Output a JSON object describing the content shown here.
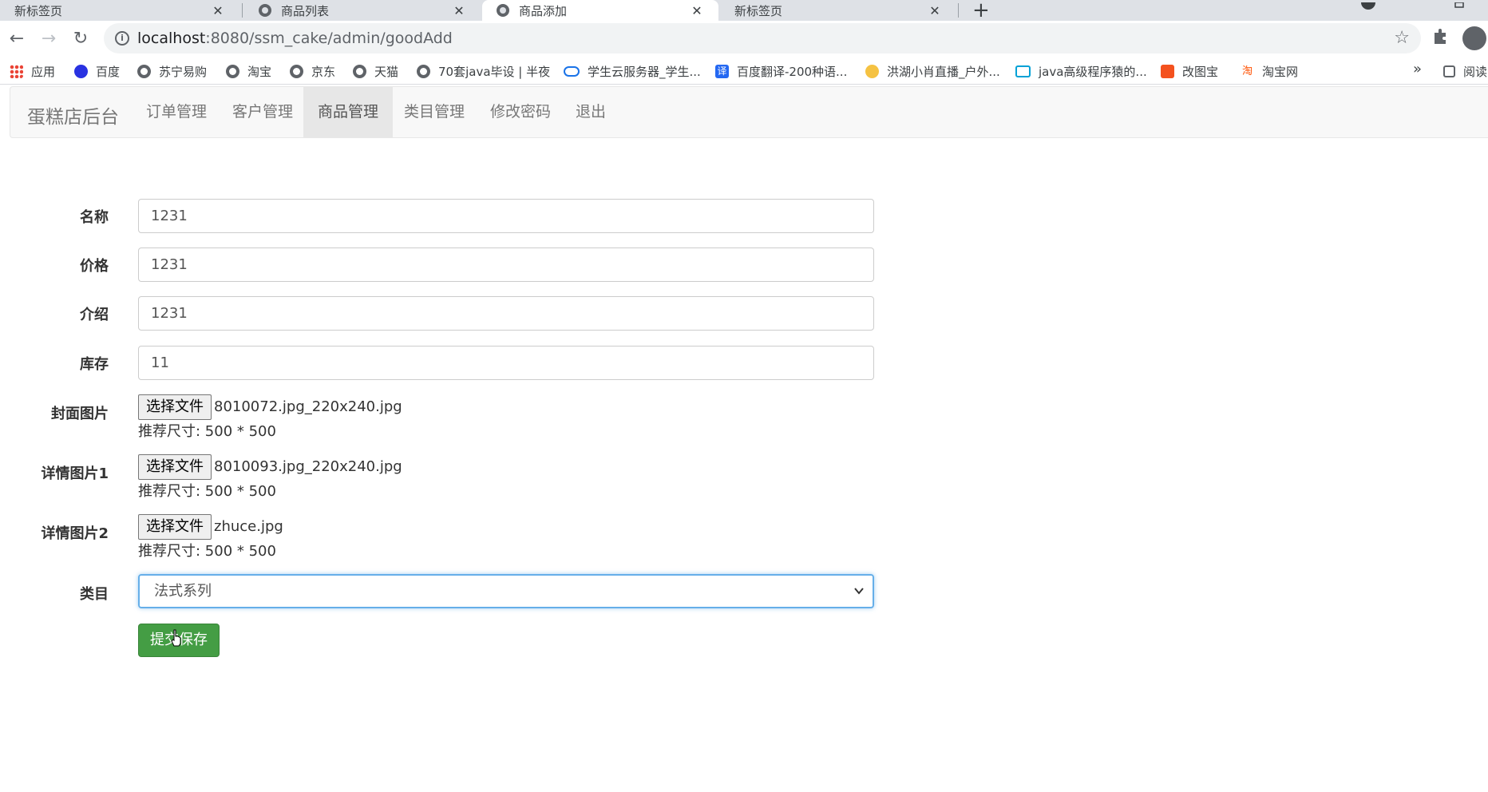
{
  "browser": {
    "tabs": [
      {
        "title": "新标签页"
      },
      {
        "title": "商品列表"
      },
      {
        "title": "商品添加"
      },
      {
        "title": "新标签页"
      }
    ],
    "url_host": "localhost",
    "url_rest": ":8080/ssm_cake/admin/goodAdd",
    "bookmarks": [
      {
        "label": "应用",
        "icon": "apps-grid-icon"
      },
      {
        "label": "百度",
        "icon": "baidu-paw-icon"
      },
      {
        "label": "苏宁易购",
        "icon": "globe-icon"
      },
      {
        "label": "淘宝",
        "icon": "globe-icon"
      },
      {
        "label": "京东",
        "icon": "globe-icon"
      },
      {
        "label": "天猫",
        "icon": "globe-icon"
      },
      {
        "label": "70套java毕设 | 半夜",
        "icon": "globe-icon"
      },
      {
        "label": "学生云服务器_学生...",
        "icon": "cloud-icon"
      },
      {
        "label": "百度翻译-200种语...",
        "icon": "translate-icon"
      },
      {
        "label": "洪湖小肖直播_户外...",
        "icon": "bird-icon"
      },
      {
        "label": "java高级程序猿的...",
        "icon": "bilibili-icon"
      },
      {
        "label": "改图宝",
        "icon": "gaitubao-icon"
      },
      {
        "label": "淘宝网",
        "icon": "taobao-icon"
      }
    ],
    "bookmarks_more": "»",
    "reading_list": "阅读"
  },
  "navbar": {
    "brand": "蛋糕店后台",
    "items": [
      {
        "label": "订单管理"
      },
      {
        "label": "客户管理"
      },
      {
        "label": "商品管理",
        "active": true
      },
      {
        "label": "类目管理"
      },
      {
        "label": "修改密码"
      },
      {
        "label": "退出"
      }
    ]
  },
  "form": {
    "name": {
      "label": "名称",
      "value": "1231"
    },
    "price": {
      "label": "价格",
      "value": "1231"
    },
    "intro": {
      "label": "介绍",
      "value": "1231"
    },
    "stock": {
      "label": "库存",
      "value": "11"
    },
    "cover": {
      "label": "封面图片",
      "button": "选择文件",
      "file": "8010072.jpg_220x240.jpg",
      "hint": "推荐尺寸: 500 * 500"
    },
    "detail1": {
      "label": "详情图片1",
      "button": "选择文件",
      "file": "8010093.jpg_220x240.jpg",
      "hint": "推荐尺寸: 500 * 500"
    },
    "detail2": {
      "label": "详情图片2",
      "button": "选择文件",
      "file": "zhuce.jpg",
      "hint": "推荐尺寸: 500 * 500"
    },
    "category": {
      "label": "类目",
      "selected": "法式系列"
    },
    "submit_label": "提交保存"
  },
  "colors": {
    "submit_bg": "#449d44",
    "focus_border": "#66afe9",
    "navbar_bg": "#f8f8f8",
    "active_nav_bg": "#e7e7e7"
  }
}
